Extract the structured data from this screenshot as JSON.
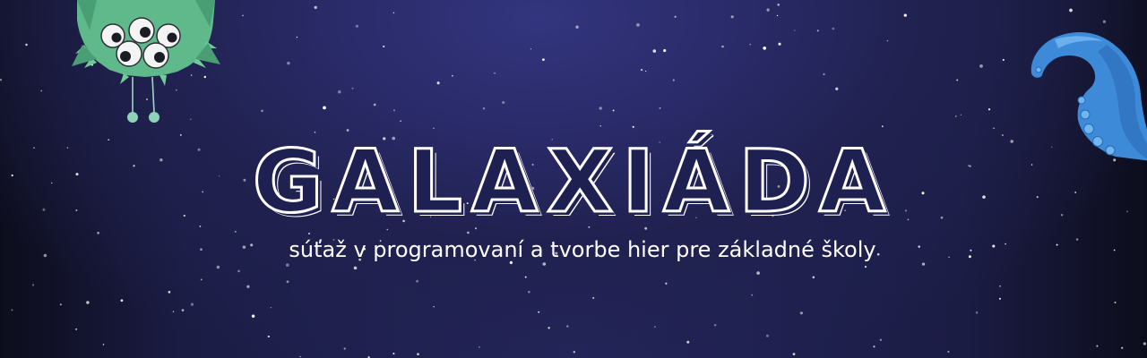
{
  "banner": {
    "title": "GALAXIÁDA",
    "subtitle": "súťaž v programovaní a tvorbe hier pre základné školy",
    "icons": {
      "left": "green-alien-icon",
      "right": "blue-tentacle-icon"
    }
  },
  "colors": {
    "background": "#24265c",
    "text": "#ffffff",
    "alien": "#5fb98a",
    "tentacle": "#3d8ad8"
  }
}
